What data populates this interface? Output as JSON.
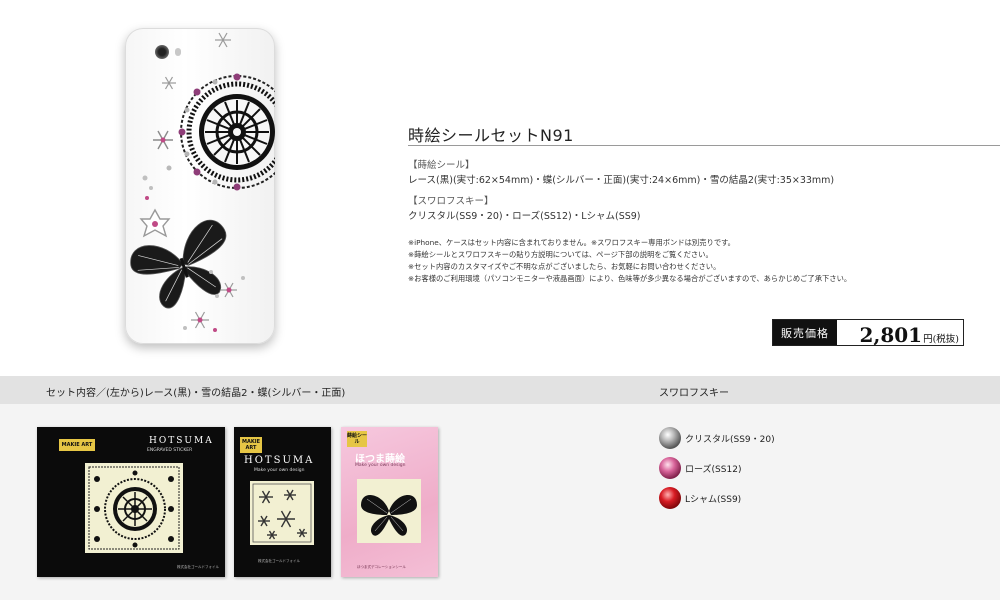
{
  "product": {
    "title": "時絵シールセットN91",
    "spec_head_1": "【蒔絵シール】",
    "spec_line_1": "レース(黒)(実寸:62×54mm)・蝶(シルバー・正面)(実寸:24×6mm)・雪の結晶2(実寸:35×33mm)",
    "spec_head_2": "【スワロフスキー】",
    "spec_line_2": "クリスタル(SS9・20)・ローズ(SS12)・Lシャム(SS9)",
    "notes": [
      "※iPhone、ケースはセット内容に含まれておりません。※スワロフスキー専用ボンドは別売りです。",
      "※蒔絵シールとスワロフスキーの貼り方説明については、ページ下部の説明をご覧ください。",
      "※セット内容のカスタマイズやご不明な点がございましたら、お気軽にお問い合わせください。",
      "※お客様のご利用環境（パソコンモニターや液晶画面）により、色味等が多少異なる場合がございますので、あらかじめご了承下さい。"
    ]
  },
  "price": {
    "label": "販売価格",
    "value": "2,801",
    "unit": "円(税抜)"
  },
  "contents": {
    "set_heading": "セット内容／(左から)レース(黒)・雪の結晶2・蝶(シルバー・正面)",
    "swarovski_heading": "スワロフスキー",
    "packages": [
      {
        "tag": "MAKIE ART",
        "brand": "HOTSUMA",
        "sub": "ENGRAVED STICKER",
        "footer": "株式会社ゴールドフォイル"
      },
      {
        "tag": "MAKIE ART",
        "brand": "HOTSUMA",
        "sub": "Make your own design",
        "footer": "株式会社ゴールドフォイル"
      },
      {
        "tag": "蒔絵シール",
        "brand": "ほつま蒔絵",
        "sub": "Make your own design",
        "footer": "ほつま式デコレーションシール"
      }
    ],
    "crystals": [
      {
        "label": "クリスタル(SS9・20)",
        "color": "#9a9a9a",
        "icon": "crystal-gem-icon"
      },
      {
        "label": "ローズ(SS12)",
        "color": "#c0406a",
        "icon": "rose-gem-icon"
      },
      {
        "label": "Lシャム(SS9)",
        "color": "#b3121a",
        "icon": "siam-gem-icon"
      }
    ]
  }
}
